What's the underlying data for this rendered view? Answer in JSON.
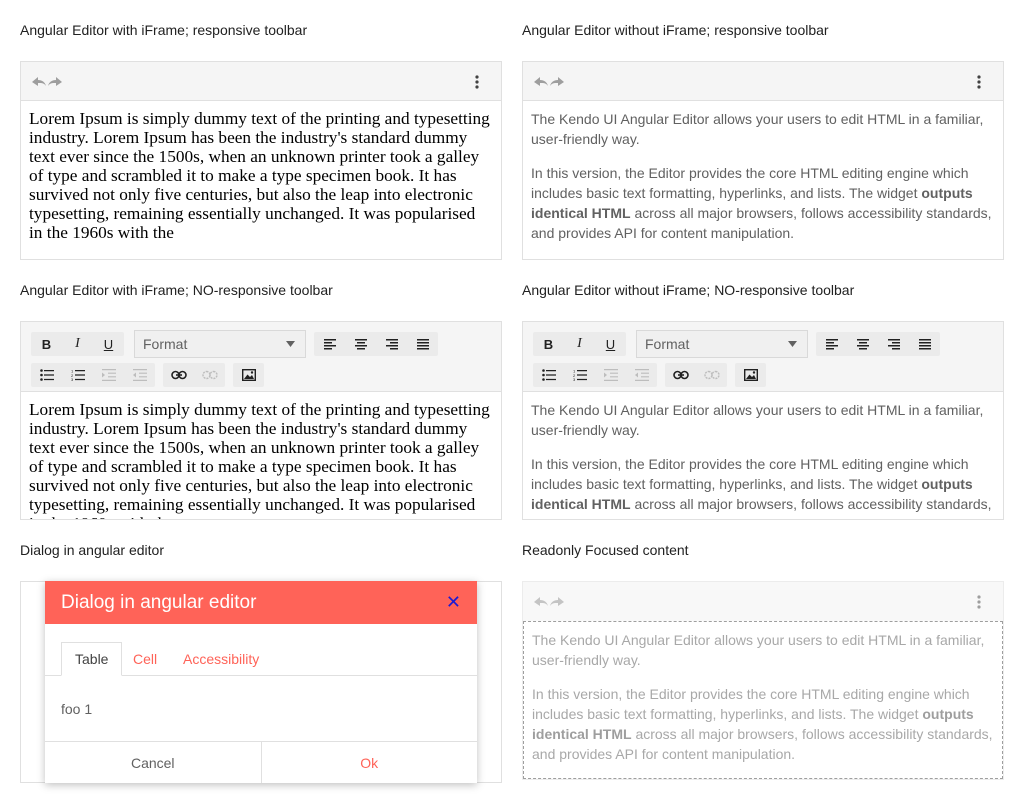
{
  "captions": {
    "c1": "Angular Editor with iFrame; responsive toolbar",
    "c2": "Angular Editor without iFrame; responsive toolbar",
    "c3": "Angular Editor with iFrame; NO-responsive toolbar",
    "c4": "Angular Editor without iFrame; NO-responsive toolbar",
    "c5": "Dialog in angular editor",
    "c6": "Readonly Focused content"
  },
  "lorem": "Lorem Ipsum is simply dummy text of the printing and typesetting industry. Lorem Ipsum has been the industry's standard dummy text ever since the 1500s, when an unknown printer took a galley of type and scrambled it to make a type specimen book. It has survived not only five centuries, but also the leap into electronic typesetting, remaining essentially unchanged. It was popularised in the 1960s with the",
  "kendo": {
    "p1": "The Kendo UI Angular Editor allows your users to edit HTML in a familiar, user-friendly way.",
    "p2_start": "In this version, the Editor provides the core HTML editing engine which includes basic text formatting, hyperlinks, and lists. The widget ",
    "p2_bold": "outputs identical HTML",
    "p2_end": " across all major browsers, follows accessibility standards, and provides API for content manipulation."
  },
  "toolbar": {
    "bold": "B",
    "italic": "I",
    "underline": "U",
    "format_value": "Format"
  },
  "dialog": {
    "title": "Dialog in angular editor",
    "close": "✕",
    "tabs": [
      "Table",
      "Cell",
      "Accessibility"
    ],
    "content": "foo 1",
    "cancel": "Cancel",
    "ok": "Ok"
  },
  "colors": {
    "accent": "#ff6358",
    "close_icon": "#1a1ad6"
  }
}
